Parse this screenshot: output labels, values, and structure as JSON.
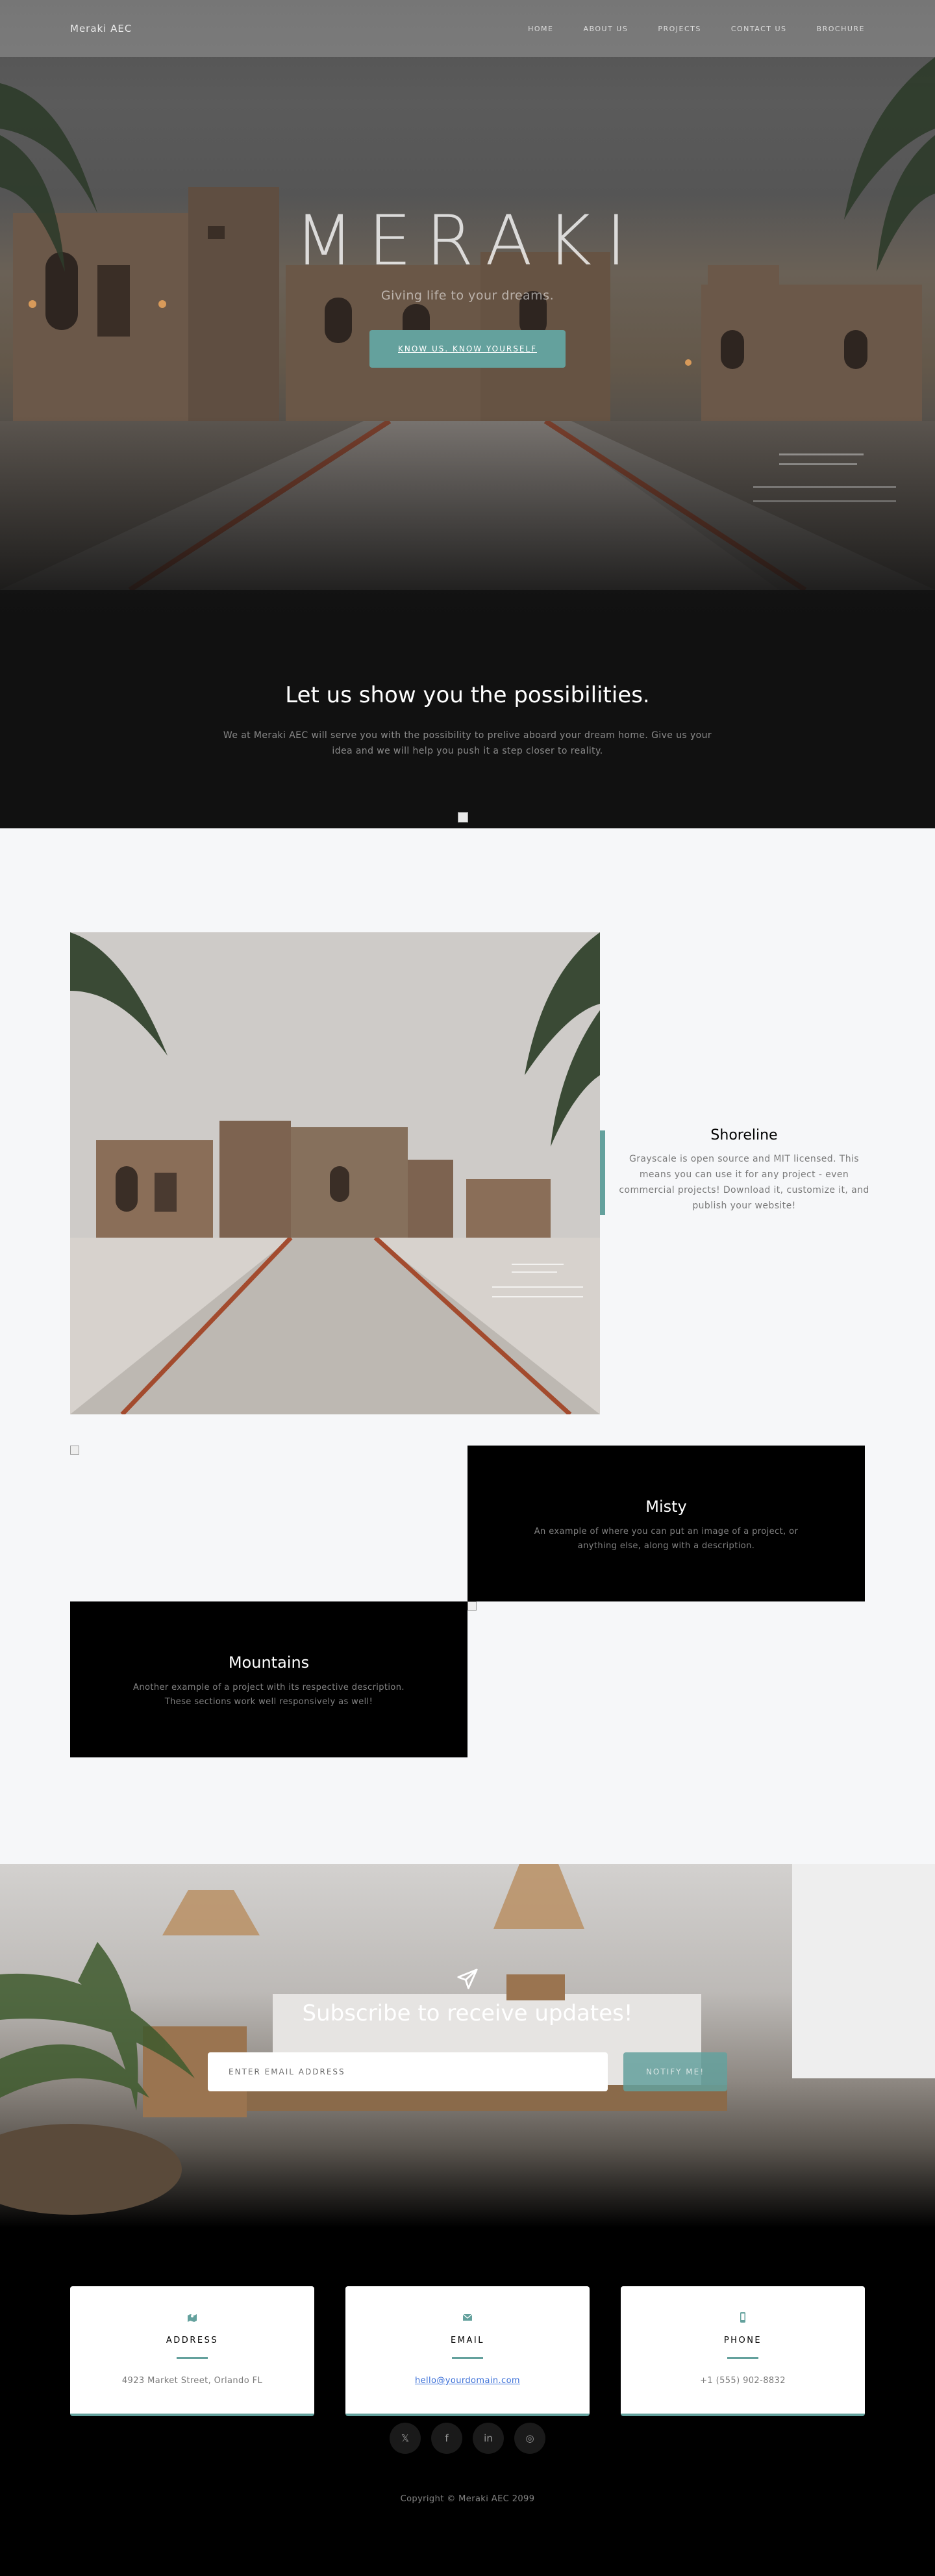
{
  "nav": {
    "brand": "Meraki AEC",
    "links": [
      "Home",
      "About Us",
      "Projects",
      "Contact Us",
      "Brochure"
    ]
  },
  "hero": {
    "title": "MERAKI",
    "subtitle": "Giving life to your dreams.",
    "button_label": "Know us. Know yourself"
  },
  "about": {
    "heading": "Let us show you the possibilities.",
    "text": "We at Meraki AEC will serve you with the possibility to prelive aboard your dream home. Give us your idea and we will help you push it a step closer to reality."
  },
  "projects": {
    "featured": {
      "title": "Shoreline",
      "description": "Grayscale is open source and MIT licensed. This means you can use it for any project - even commercial projects! Download it, customize it, and publish your website!"
    },
    "items": [
      {
        "title": "Misty",
        "description": "An example of where you can put an image of a project, or anything else, along with a description."
      },
      {
        "title": "Mountains",
        "description": "Another example of a project with its respective description. These sections work well responsively as well!"
      }
    ]
  },
  "signup": {
    "heading": "Subscribe to receive updates!",
    "placeholder": "Enter email address",
    "button_label": "Notify Me!"
  },
  "contact": {
    "address": {
      "label": "Address",
      "value": "4923 Market Street, Orlando FL"
    },
    "email": {
      "label": "Email",
      "value": "hello@yourdomain.com"
    },
    "phone": {
      "label": "Phone",
      "value": "+1 (555) 902-8832"
    }
  },
  "social": [
    "twitter-icon",
    "facebook-icon",
    "linkedin-icon",
    "whatsapp-icon"
  ],
  "footer": {
    "copyright": "Copyright © Meraki AEC 2099"
  },
  "colors": {
    "accent": "#64a19d",
    "dark": "#000000",
    "light_bg": "#f6f7f9"
  }
}
